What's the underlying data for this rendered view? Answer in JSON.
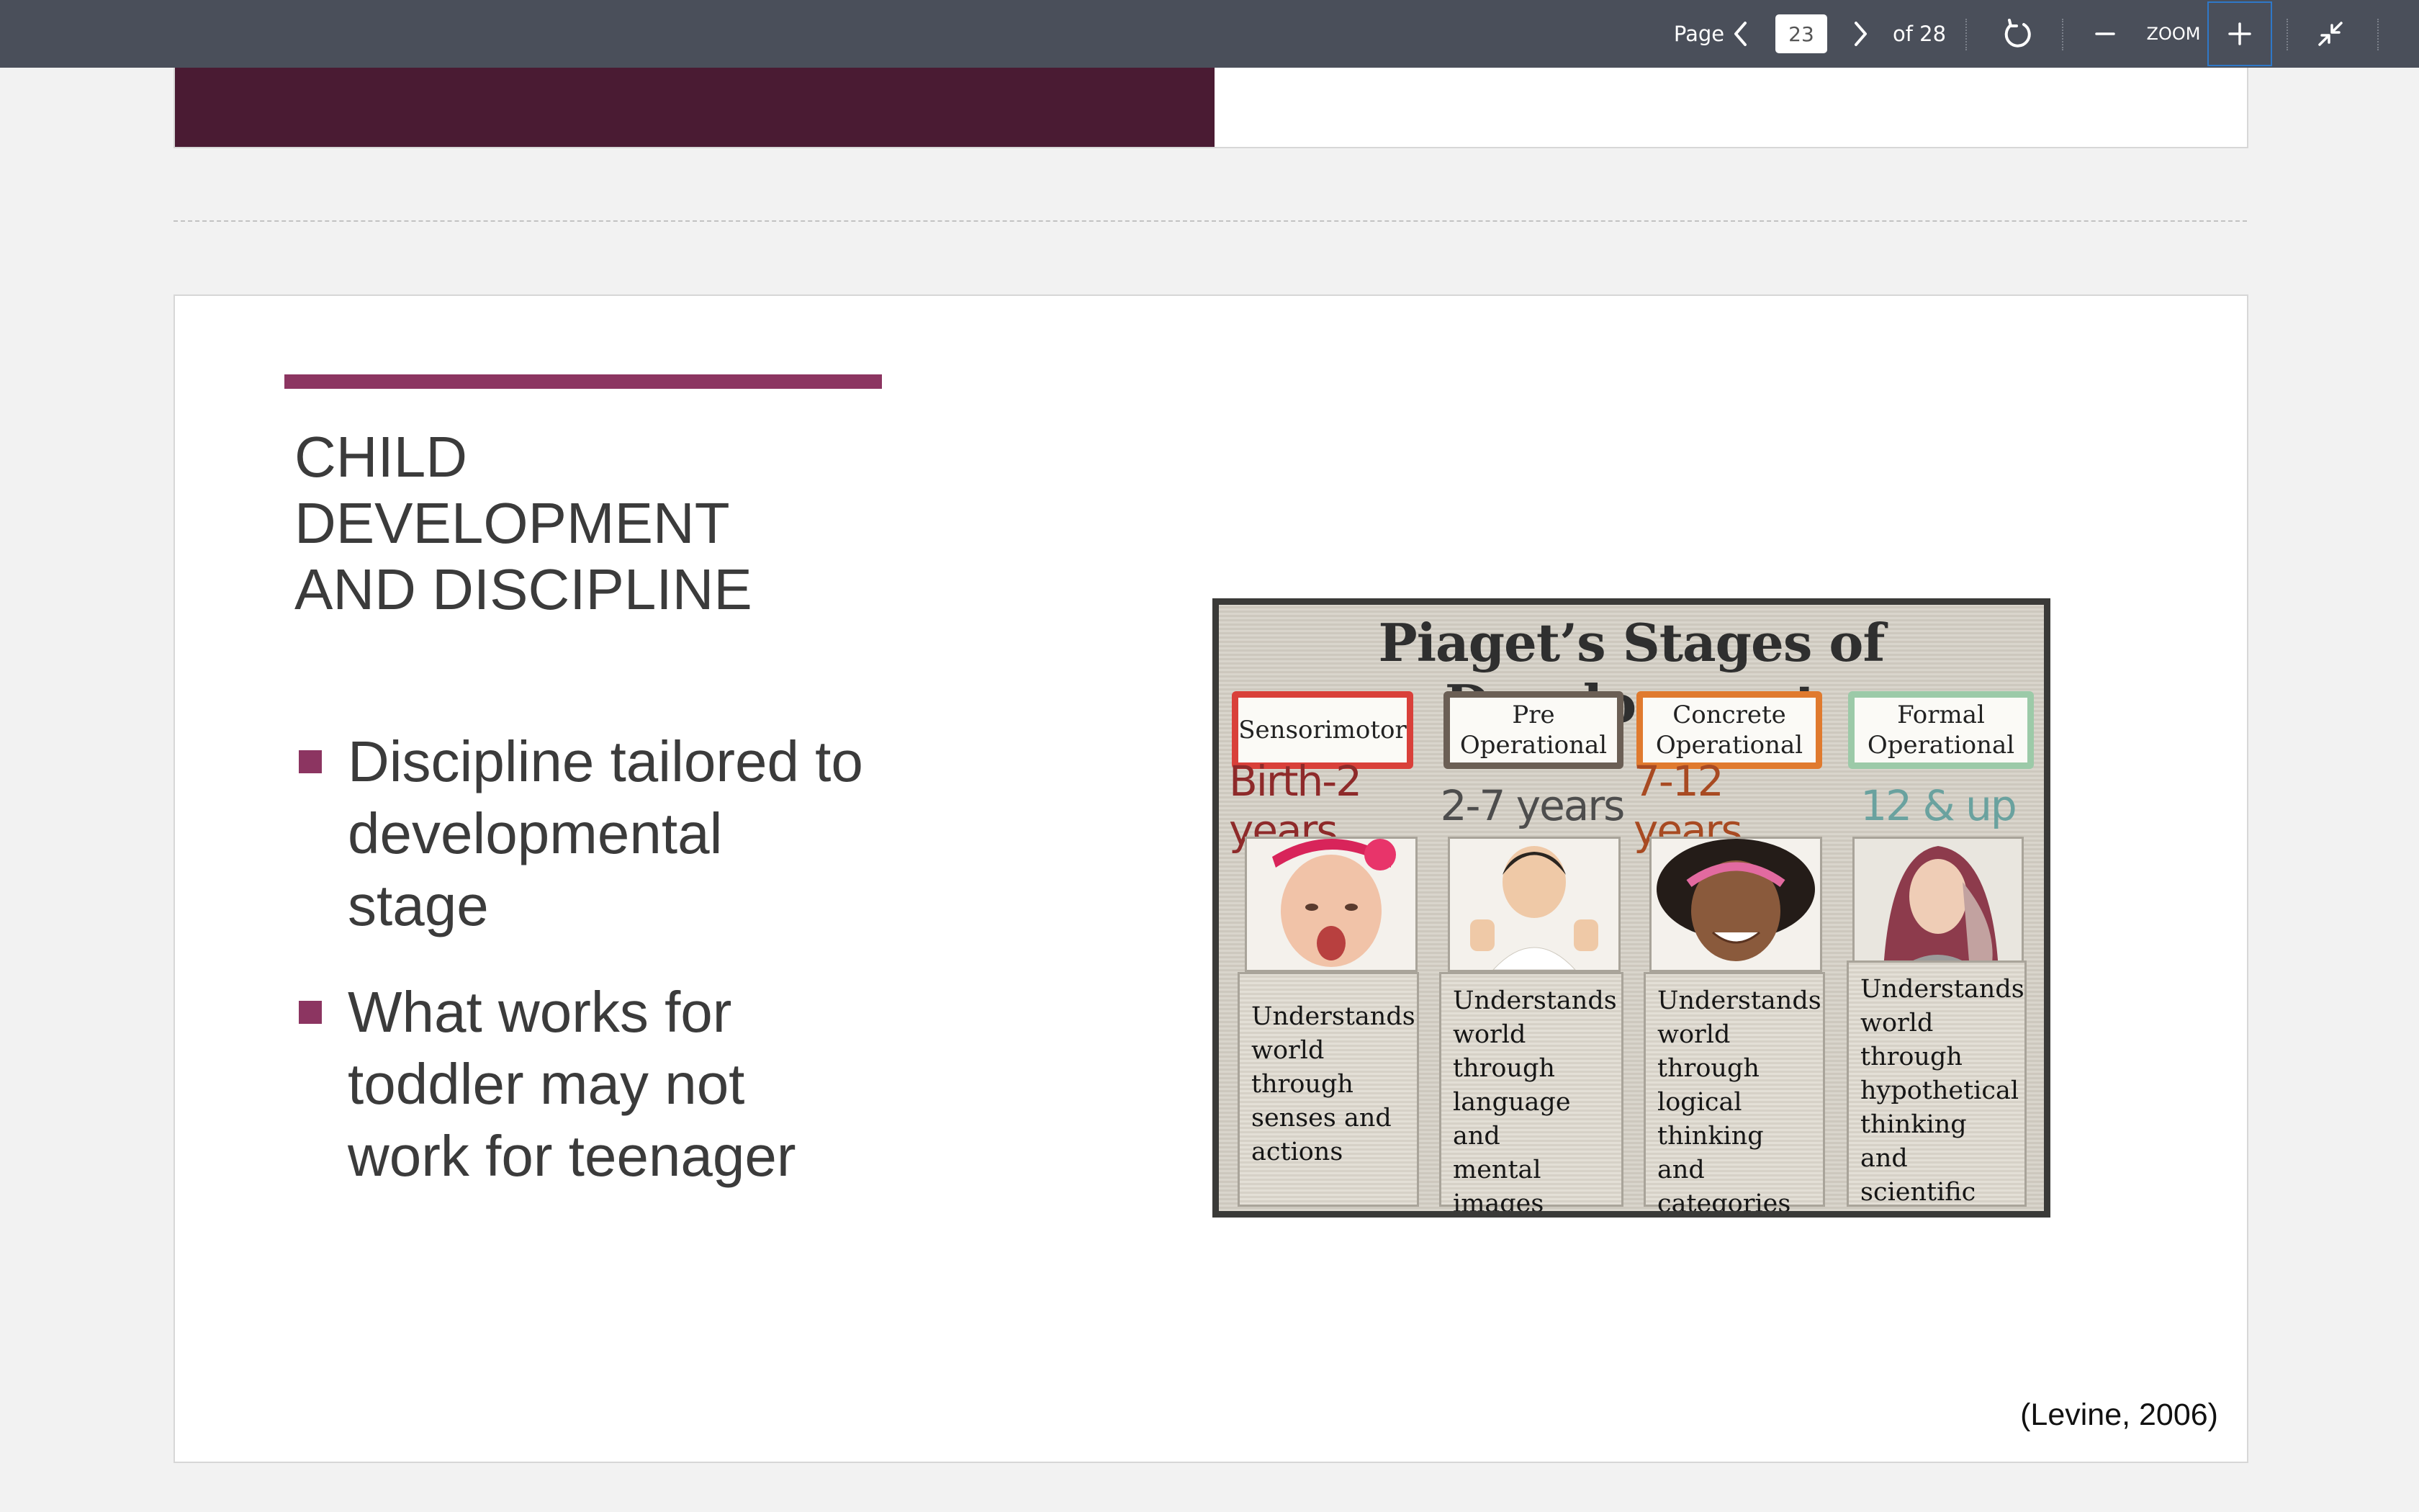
{
  "toolbar": {
    "page_label": "Page",
    "current_page": "23",
    "total_pages": "of 28",
    "zoom_label": "ZOOM",
    "icons": {
      "prev": "chevron-left-icon",
      "next": "chevron-right-icon",
      "rotate": "rotate-icon",
      "zoom_out": "minus-icon",
      "zoom_in": "plus-icon",
      "exit_fullscreen": "collapse-icon"
    },
    "colors": {
      "background": "#4a4f5a",
      "focus_outline": "#2f78c8"
    }
  },
  "previous_slide": {
    "band_color": "#4a1b33"
  },
  "slide": {
    "title_lines": [
      "CHILD",
      "DEVELOPMENT",
      "AND DISCIPLINE"
    ],
    "accent_color": "#8c3561",
    "bullets": [
      "Discipline tailored to developmental stage",
      "What works for toddler may not work for teenager"
    ],
    "citation": "(Levine, 2006)"
  },
  "infographic": {
    "title": "Piaget’s Stages of Development",
    "stages": [
      {
        "name": "Sensorimotor",
        "age": "Birth-2 years",
        "description": "Understands\nworld\nthrough\nsenses and\nactions",
        "border_color": "#d9403a",
        "age_color": "#8e2a2a"
      },
      {
        "name": "Pre\nOperational",
        "age": "2-7 years",
        "description": "Understands\nworld\nthrough\nlanguage and\nmental\nimages",
        "border_color": "#6b5f55",
        "age_color": "#4d4d4d"
      },
      {
        "name": "Concrete\nOperational",
        "age": "7-12 years",
        "description": "Understands\nworld\nthrough\nlogical\nthinking and\ncategories",
        "border_color": "#e07a2e",
        "age_color": "#a84a22"
      },
      {
        "name": "Formal\nOperational",
        "age": "12 & up",
        "description": "Understands\nworld\nthrough\nhypothetical\nthinking and\nscientific\nreasoning",
        "border_color": "#9ccaa8",
        "age_color": "#6aa29f"
      }
    ]
  }
}
